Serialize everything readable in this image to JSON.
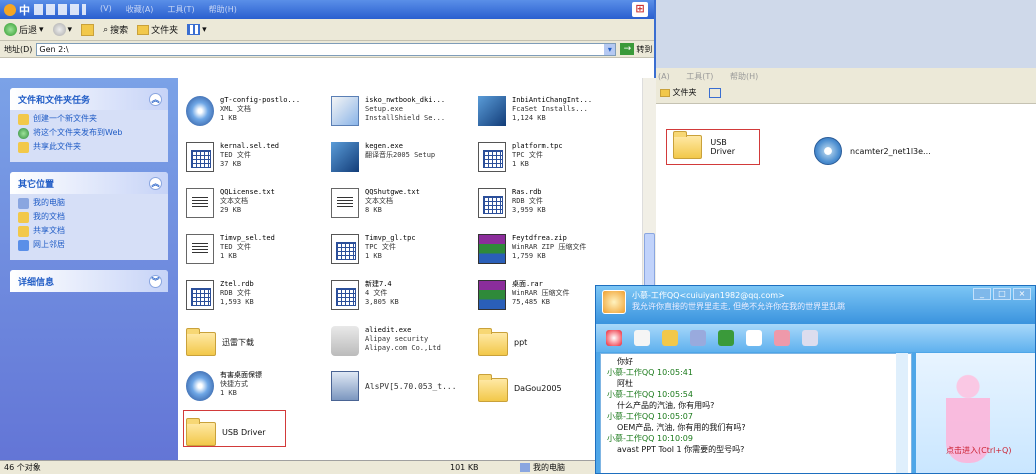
{
  "bg_window": {
    "menu": [
      "(A)",
      "工具(T)",
      "帮助(H)"
    ],
    "toolbar": {
      "folders_label": "文件夹"
    },
    "items": [
      {
        "label": "USB Driver",
        "icon": "folder-icon"
      },
      {
        "label": "ncamter2_net1l3e...",
        "icon": "cd-installer-icon"
      }
    ]
  },
  "main_window": {
    "title": "中",
    "menu": [
      "(V)",
      "收藏(A)",
      "工具(T)",
      "帮助(H)"
    ],
    "toolbar": {
      "back": "后退",
      "search": "搜索",
      "folders": "文件夹"
    },
    "address": {
      "label": "地址(D)",
      "value": "Gen 2:\\",
      "go": "转到"
    }
  },
  "left_panel": {
    "tasks": {
      "title": "文件和文件夹任务",
      "items": [
        "创建一个新文件夹",
        "将这个文件夹发布到Web",
        "共享此文件夹"
      ]
    },
    "places": {
      "title": "其它位置",
      "items": [
        "我的电脑",
        "我的文档",
        "共享文档",
        "网上邻居"
      ]
    },
    "details": {
      "title": "详细信息"
    }
  },
  "files": [
    {
      "name": "gT-config-postlo...",
      "type": "XML 文档",
      "size": "1 KB",
      "icon": "globe-icon"
    },
    {
      "name": "isko_nwtbook_dki...",
      "type": "Setup.exe",
      "size": "InstallShield Se...",
      "icon": "installer-icon"
    },
    {
      "name": "InbiAntiChangInt...",
      "type": "FcaSet Installs...",
      "size": "1,124 KB",
      "icon": "setup-icon"
    },
    {
      "name": "kernal.sel.ted",
      "type": "TED 文件",
      "size": "37 KB",
      "icon": "grid-file-icon"
    },
    {
      "name": "kegen.exe",
      "type": "翻译音乐2005 Setup",
      "size": "",
      "icon": "setup-icon"
    },
    {
      "name": "platform.tpc",
      "type": "TPC 文件",
      "size": "1 KB",
      "icon": "grid-file-icon"
    },
    {
      "name": "QQLicense.txt",
      "type": "文本文档",
      "size": "29 KB",
      "icon": "text-file-icon"
    },
    {
      "name": "QQShutgwe.txt",
      "type": "文本文档",
      "size": "8 KB",
      "icon": "text-file-icon"
    },
    {
      "name": "Ras.rdb",
      "type": "RDB 文件",
      "size": "3,959 KB",
      "icon": "grid-file-icon"
    },
    {
      "name": "Timvp_sel.ted",
      "type": "TED 文件",
      "size": "1 KB",
      "icon": "text-file-icon"
    },
    {
      "name": "Timvp_gl.tpc",
      "type": "TPC 文件",
      "size": "1 KB",
      "icon": "grid-file-icon"
    },
    {
      "name": "Feytdfrea.zip",
      "type": "WinRAR ZIP 压缩文件",
      "size": "1,759 KB",
      "icon": "winrar-icon"
    },
    {
      "name": "Ztel.rdb",
      "type": "RDB 文件",
      "size": "1,593 KB",
      "icon": "grid-file-icon"
    },
    {
      "name": "新建7.4",
      "type": "4 文件",
      "size": "3,805 KB",
      "icon": "grid-file-icon"
    },
    {
      "name": "桌面.rar",
      "type": "WinRAR 压缩文件",
      "size": "75,485 KB",
      "icon": "winrar-icon"
    },
    {
      "name": "迅雷下载",
      "type": "",
      "size": "",
      "icon": "folder-icon"
    },
    {
      "name": "aliedit.exe",
      "type": "Alipay security",
      "size": "Alipay.com Co.,Ltd",
      "icon": "logo-icon"
    },
    {
      "name": "ppt",
      "type": "",
      "size": "",
      "icon": "folder-icon"
    },
    {
      "name": "有害桌面保镖",
      "type": "快捷方式",
      "size": "1 KB",
      "icon": "shortcut-icon"
    },
    {
      "name": "AlsPV[5.70.053_t...",
      "type": "",
      "size": "",
      "icon": "pc-icon"
    },
    {
      "name": "DaGou2005",
      "type": "",
      "size": "",
      "icon": "folder-icon"
    },
    {
      "name": "USB Driver",
      "type": "",
      "size": "",
      "icon": "folder-icon"
    }
  ],
  "status": {
    "count": "46 个对象",
    "size": "101 KB",
    "location": "我的电脑"
  },
  "qq": {
    "name": "小慕-工作QQ<cuiuiyan1982@qq.com>",
    "status": "我允许你直接的世界里走走, 但绝不允许你在我的世界里乱跳",
    "messages": [
      {
        "head": "",
        "body": "你好"
      },
      {
        "head": "小慕-工作QQ  10:05:41",
        "body": "阿杜"
      },
      {
        "head": "小慕-工作QQ  10:05:54",
        "body": "什么产品的汽油, 你有用吗?"
      },
      {
        "head": "小慕-工作QQ  10:05:07",
        "body": "OEM产品, 汽油, 你有用的我们有吗?"
      },
      {
        "head": "小慕-工作QQ  10:10:09",
        "body": "avast PPT Tool 1 你需要的型号吗?"
      }
    ],
    "side_text": "点击进入(Ctrl+Q)"
  }
}
